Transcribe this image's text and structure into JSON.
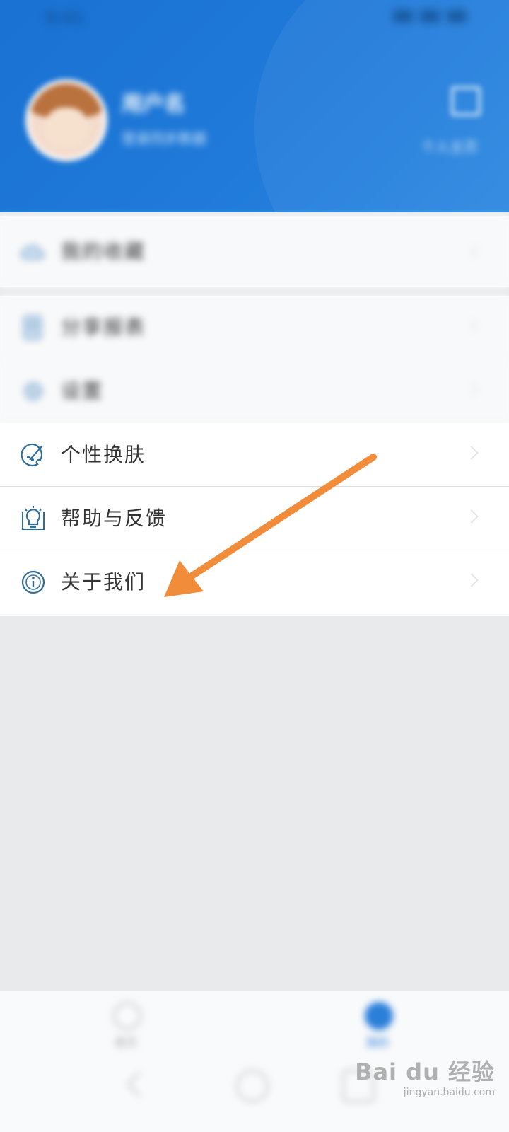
{
  "status_bar": {
    "time": "9:41"
  },
  "profile": {
    "name": "用户名",
    "subtitle": "登录同步数据",
    "link": "个人主页"
  },
  "menu": {
    "group1": [
      {
        "label": "我的收藏",
        "icon": "cloud-icon"
      }
    ],
    "group2": [
      {
        "label": "分享报表",
        "icon": "document-icon"
      },
      {
        "label": "设置",
        "icon": "gear-icon"
      },
      {
        "label": "个性换肤",
        "icon": "palette-icon"
      },
      {
        "label": "帮助与反馈",
        "icon": "lightbulb-icon"
      },
      {
        "label": "关于我们",
        "icon": "info-icon"
      }
    ]
  },
  "bottom_nav": {
    "tabs": [
      {
        "label": "首页",
        "icon": "home-icon"
      },
      {
        "label": "我的",
        "icon": "person-icon"
      }
    ]
  },
  "watermark": {
    "main": "Bai du 经验",
    "sub": "jingyan.baidu.com"
  },
  "colors": {
    "header_blue": "#1a72d2",
    "arrow_orange": "#f08c3a",
    "icon_blue": "#2f6e9c"
  }
}
